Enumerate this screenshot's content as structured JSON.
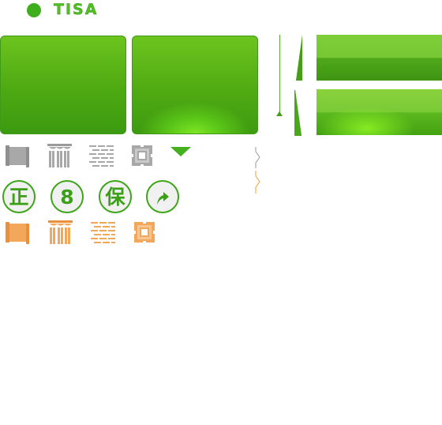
{
  "header": {
    "brand": "TISA"
  },
  "badges": {
    "zheng": "正",
    "eight": "8",
    "bao": "保"
  },
  "colors": {
    "green_primary": "#4ea912",
    "green_light": "#7ee626",
    "gray_icon": "#a8a8a8",
    "orange_icon": "#f3a75b"
  },
  "icons": {
    "gray_row": [
      "scroll-icon",
      "columns-icon",
      "brick-wall-icon",
      "frame-icon",
      "triangle-down-icon"
    ],
    "orange_row": [
      "scroll-icon",
      "columns-icon",
      "brick-wall-icon",
      "frame-icon"
    ],
    "badge_row": [
      "zheng-badge",
      "eight-badge",
      "bao-badge",
      "upload-arrow-icon"
    ],
    "side": [
      "chevron-right-icon"
    ]
  }
}
